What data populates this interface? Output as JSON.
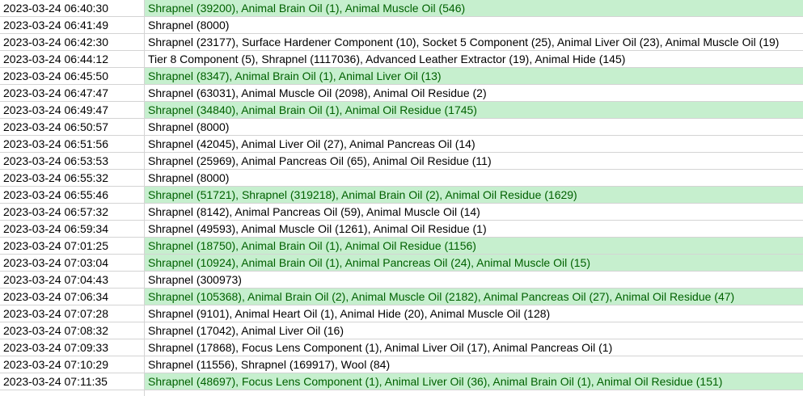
{
  "colors": {
    "highlight_fill": "#c6efce",
    "highlight_text": "#006100",
    "gridline": "#d4d4d4"
  },
  "rows": [
    {
      "timestamp": "2023-03-24 06:40:30",
      "items": "Shrapnel (39200), Animal Brain Oil (1), Animal Muscle Oil (546)",
      "highlighted": true
    },
    {
      "timestamp": "2023-03-24 06:41:49",
      "items": "Shrapnel (8000)",
      "highlighted": false
    },
    {
      "timestamp": "2023-03-24 06:42:30",
      "items": "Shrapnel (23177), Surface Hardener Component (10), Socket 5 Component (25), Animal Liver Oil (23), Animal Muscle Oil (19)",
      "highlighted": false
    },
    {
      "timestamp": "2023-03-24 06:44:12",
      "items": "Tier 8 Component (5), Shrapnel (1117036), Advanced Leather Extractor (19), Animal Hide (145)",
      "highlighted": false
    },
    {
      "timestamp": "2023-03-24 06:45:50",
      "items": "Shrapnel (8347), Animal Brain Oil (1), Animal Liver Oil (13)",
      "highlighted": true
    },
    {
      "timestamp": "2023-03-24 06:47:47",
      "items": "Shrapnel (63031), Animal Muscle Oil (2098), Animal Oil Residue (2)",
      "highlighted": false
    },
    {
      "timestamp": "2023-03-24 06:49:47",
      "items": "Shrapnel (34840), Animal Brain Oil (1), Animal Oil Residue (1745)",
      "highlighted": true
    },
    {
      "timestamp": "2023-03-24 06:50:57",
      "items": "Shrapnel (8000)",
      "highlighted": false
    },
    {
      "timestamp": "2023-03-24 06:51:56",
      "items": "Shrapnel (42045), Animal Liver Oil (27), Animal Pancreas Oil (14)",
      "highlighted": false
    },
    {
      "timestamp": "2023-03-24 06:53:53",
      "items": "Shrapnel (25969), Animal Pancreas Oil (65), Animal Oil Residue (11)",
      "highlighted": false
    },
    {
      "timestamp": "2023-03-24 06:55:32",
      "items": "Shrapnel (8000)",
      "highlighted": false
    },
    {
      "timestamp": "2023-03-24 06:55:46",
      "items": "Shrapnel (51721), Shrapnel (319218), Animal Brain Oil (2), Animal Oil Residue (1629)",
      "highlighted": true
    },
    {
      "timestamp": "2023-03-24 06:57:32",
      "items": "Shrapnel (8142), Animal Pancreas Oil (59), Animal Muscle Oil (14)",
      "highlighted": false
    },
    {
      "timestamp": "2023-03-24 06:59:34",
      "items": "Shrapnel (49593), Animal Muscle Oil (1261), Animal Oil Residue (1)",
      "highlighted": false
    },
    {
      "timestamp": "2023-03-24 07:01:25",
      "items": "Shrapnel (18750), Animal Brain Oil (1), Animal Oil Residue (1156)",
      "highlighted": true
    },
    {
      "timestamp": "2023-03-24 07:03:04",
      "items": "Shrapnel (10924), Animal Brain Oil (1), Animal Pancreas Oil (24), Animal Muscle Oil (15)",
      "highlighted": true
    },
    {
      "timestamp": "2023-03-24 07:04:43",
      "items": "Shrapnel (300973)",
      "highlighted": false
    },
    {
      "timestamp": "2023-03-24 07:06:34",
      "items": "Shrapnel (105368), Animal Brain Oil (2), Animal Muscle Oil (2182), Animal Pancreas Oil (27), Animal Oil Residue (47)",
      "highlighted": true
    },
    {
      "timestamp": "2023-03-24 07:07:28",
      "items": "Shrapnel (9101), Animal Heart Oil (1), Animal Hide (20), Animal Muscle Oil (128)",
      "highlighted": false
    },
    {
      "timestamp": "2023-03-24 07:08:32",
      "items": "Shrapnel (17042), Animal Liver Oil (16)",
      "highlighted": false
    },
    {
      "timestamp": "2023-03-24 07:09:33",
      "items": "Shrapnel (17868), Focus Lens Component (1), Animal Liver Oil (17), Animal Pancreas Oil (1)",
      "highlighted": false
    },
    {
      "timestamp": "2023-03-24 07:10:29",
      "items": "Shrapnel (11556), Shrapnel (169917), Wool (84)",
      "highlighted": false
    },
    {
      "timestamp": "2023-03-24 07:11:35",
      "items": "Shrapnel (48697), Focus Lens Component (1), Animal Liver Oil (36), Animal Brain Oil (1), Animal Oil Residue (151)",
      "highlighted": true
    }
  ]
}
